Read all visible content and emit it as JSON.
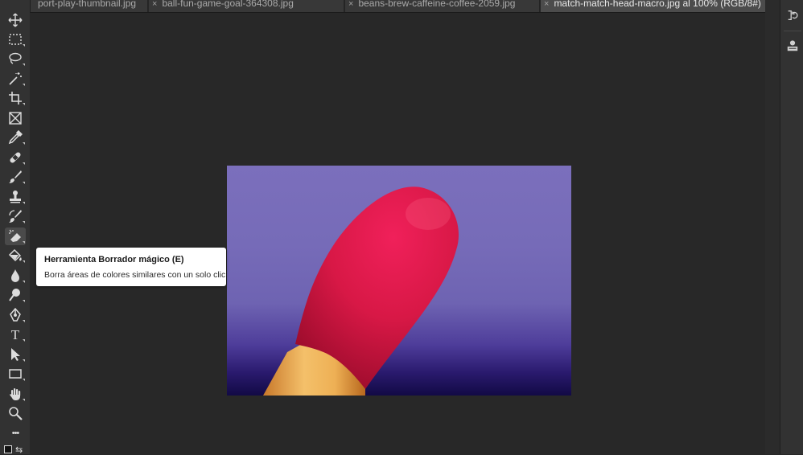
{
  "tabs": [
    {
      "label": "port-play-thumbnail.jpg",
      "close": "",
      "active": false
    },
    {
      "label": "ball-fun-game-goal-364308.jpg",
      "close": "×",
      "active": false
    },
    {
      "label": "beans-brew-caffeine-coffee-2059.jpg",
      "close": "×",
      "active": false
    },
    {
      "label": "match-match-head-macro.jpg al 100% (RGB/8#)",
      "close": "×",
      "active": true
    }
  ],
  "tabbar": {
    "overflow_label": "»"
  },
  "tools": [
    {
      "name": "move-tool",
      "icon": "move-icon",
      "active": false
    },
    {
      "name": "rectangular-marquee-tool",
      "icon": "marquee-icon",
      "active": false
    },
    {
      "name": "lasso-tool",
      "icon": "lasso-icon",
      "active": false
    },
    {
      "name": "magic-wand-tool",
      "icon": "magic-wand-icon",
      "active": false
    },
    {
      "name": "crop-tool",
      "icon": "crop-icon",
      "active": false
    },
    {
      "name": "frame-tool",
      "icon": "frame-icon",
      "active": false
    },
    {
      "name": "eyedropper-tool",
      "icon": "eyedropper-icon",
      "active": false
    },
    {
      "name": "healing-brush-tool",
      "icon": "bandage-icon",
      "active": false
    },
    {
      "name": "brush-tool",
      "icon": "brush-icon",
      "active": false
    },
    {
      "name": "clone-stamp-tool",
      "icon": "stamp-icon",
      "active": false
    },
    {
      "name": "history-brush-tool",
      "icon": "history-brush-icon",
      "active": false
    },
    {
      "name": "magic-eraser-tool",
      "icon": "magic-eraser-icon",
      "active": true
    },
    {
      "name": "paint-bucket-tool",
      "icon": "paint-bucket-icon",
      "active": false
    },
    {
      "name": "blur-tool",
      "icon": "drop-icon",
      "active": false
    },
    {
      "name": "dodge-tool",
      "icon": "dodge-icon",
      "active": false
    },
    {
      "name": "pen-tool",
      "icon": "pen-icon",
      "active": false
    },
    {
      "name": "type-tool",
      "icon": "type-icon",
      "active": false
    },
    {
      "name": "path-selection-tool",
      "icon": "arrow-icon",
      "active": false
    },
    {
      "name": "rectangle-tool",
      "icon": "rectangle-icon",
      "active": false
    },
    {
      "name": "hand-tool",
      "icon": "hand-icon",
      "active": false
    },
    {
      "name": "zoom-tool",
      "icon": "zoom-icon",
      "active": false
    },
    {
      "name": "more-tools",
      "icon": "ellipsis-icon",
      "active": false
    }
  ],
  "tooltip": {
    "title": "Herramienta Borrador mágico (E)",
    "description": "Borra áreas de colores similares con un solo clic"
  },
  "toolbar": {
    "type_glyph": "T",
    "ellipsis_glyph": "•••"
  },
  "colors": {
    "match_head": "#d41a45",
    "background": "#6f65b4",
    "stick": "#e8a64a"
  }
}
